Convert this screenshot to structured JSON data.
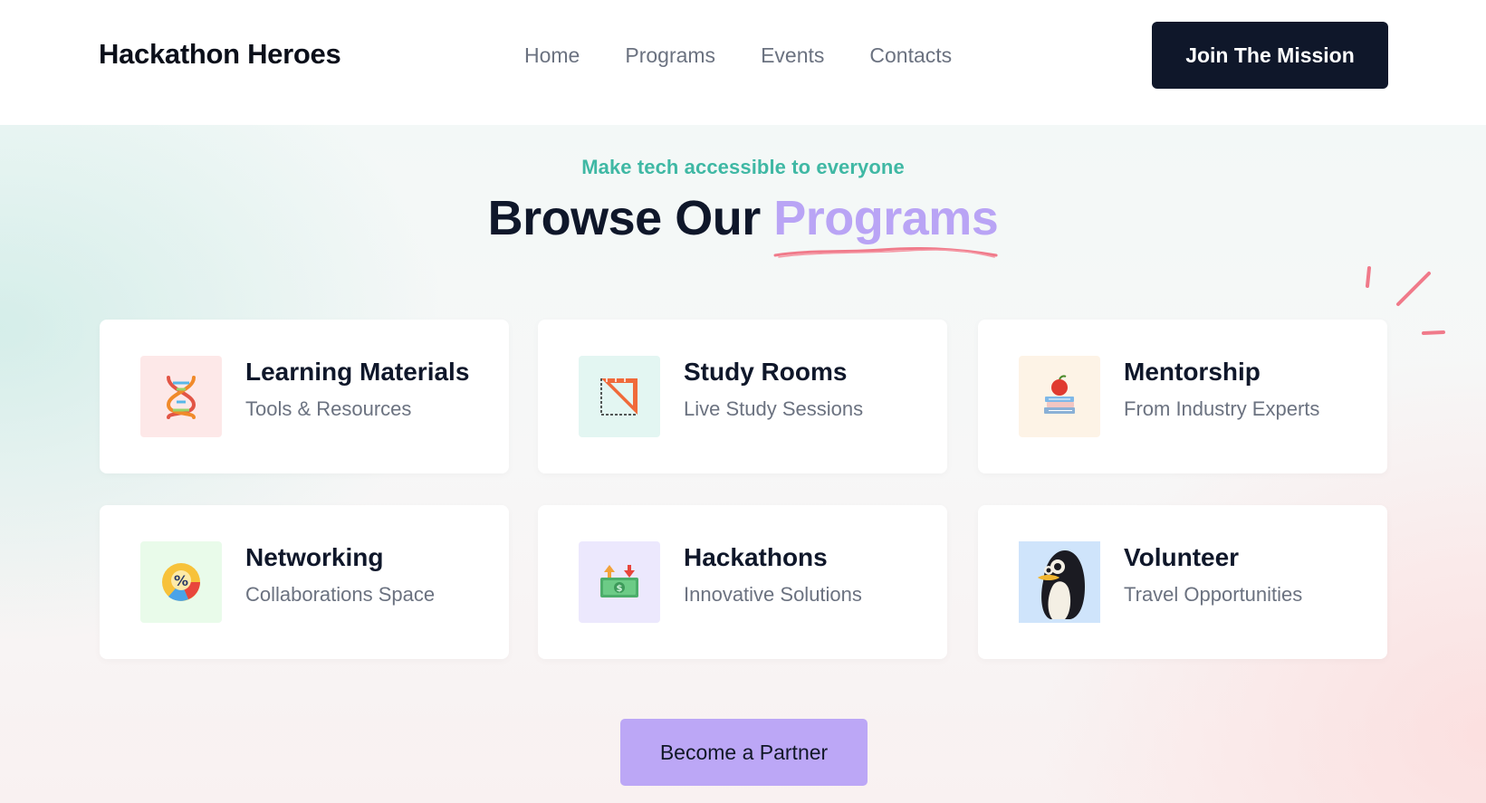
{
  "header": {
    "logo": "Hackathon Heroes",
    "nav": [
      "Home",
      "Programs",
      "Events",
      "Contacts"
    ],
    "cta": "Join The Mission"
  },
  "hero": {
    "eyebrow": "Make tech accessible to everyone",
    "title_main": "Browse Our",
    "title_accent": "Programs",
    "accent_color": "#b9a4f5",
    "eyebrow_color": "#3fb8a4"
  },
  "programs": [
    {
      "title": "Learning Materials",
      "subtitle": "Tools & Resources",
      "icon": "dna-icon",
      "bg": "#fde8e8"
    },
    {
      "title": "Study Rooms",
      "subtitle": "Live Study Sessions",
      "icon": "set-square-icon",
      "bg": "#e3f6f2"
    },
    {
      "title": "Mentorship",
      "subtitle": "From Industry Experts",
      "icon": "apple-books-icon",
      "bg": "#fdf3e6"
    },
    {
      "title": "Networking",
      "subtitle": "Collaborations Space",
      "icon": "percent-chart-icon",
      "bg": "#e9fbea"
    },
    {
      "title": "Hackathons",
      "subtitle": "Innovative Solutions",
      "icon": "money-arrows-icon",
      "bg": "#ece8fd"
    },
    {
      "title": "Volunteer",
      "subtitle": "Travel Opportunities",
      "icon": "penguin-icon",
      "bg": "#cfe4fb"
    }
  ],
  "partner_button": "Become a Partner",
  "colors": {
    "header_cta_bg": "#0f172a",
    "partner_bg": "#bca7f6",
    "underline": "#f07a8a"
  }
}
